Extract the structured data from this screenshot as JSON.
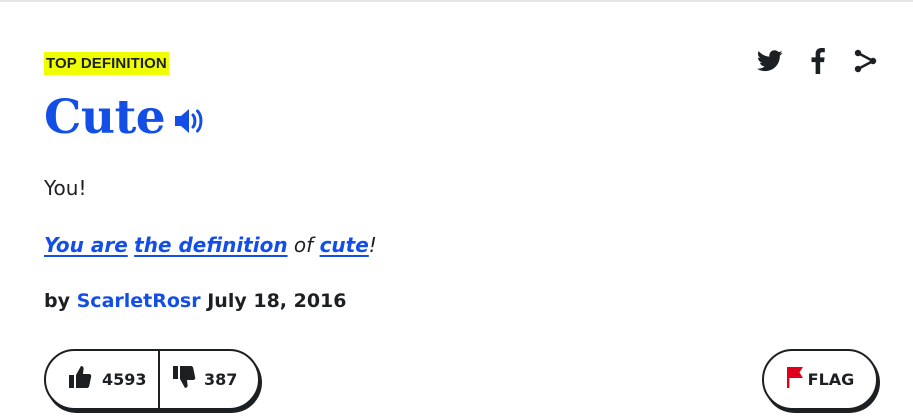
{
  "badge": {
    "label": "TOP DEFINITION"
  },
  "share": {
    "icons": [
      "twitter-icon",
      "facebook-icon",
      "share-icon"
    ]
  },
  "entry": {
    "word": "Cute",
    "meaning": "You!",
    "example": {
      "part1": "You are",
      "part2": "the definition",
      "part3": " of ",
      "part4": "cute",
      "part5": "!"
    },
    "contributor_prefix": "by",
    "author": "ScarletRosr",
    "date": "July 18, 2016"
  },
  "votes": {
    "up": "4593",
    "down": "387"
  },
  "flag": {
    "label": "FLAG"
  },
  "colors": {
    "link": "#134fe6",
    "badge_bg": "#efff00",
    "text": "#1d2023",
    "flag": "#e0001b"
  }
}
